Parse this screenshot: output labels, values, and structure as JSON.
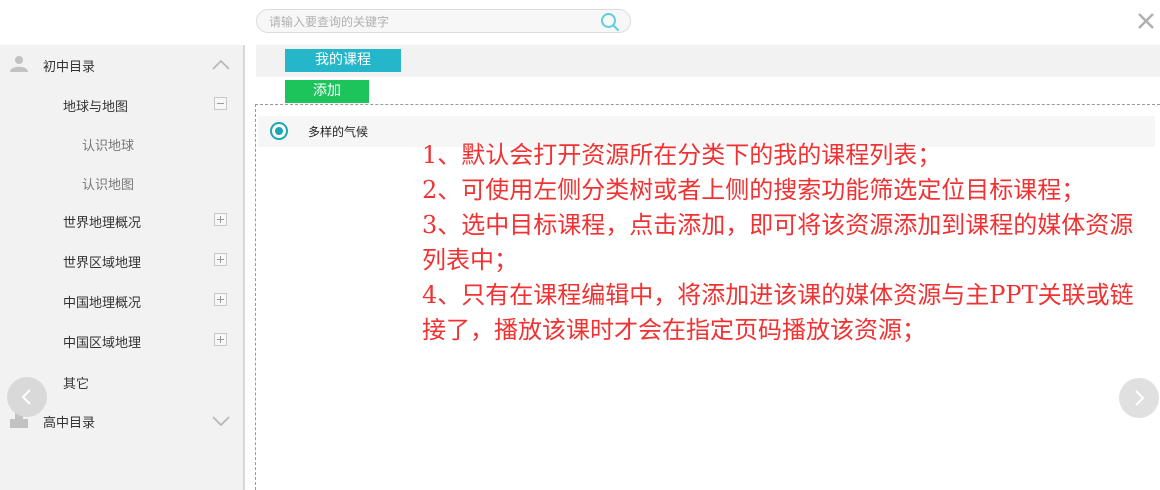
{
  "search": {
    "placeholder": "请输入要查询的关键字"
  },
  "sidebar": {
    "groups": [
      {
        "label": "初中目录",
        "nodes": [
          {
            "label": "地球与地图",
            "children": [
              "认识地球",
              "认识地图"
            ]
          },
          {
            "label": "世界地理概况"
          },
          {
            "label": "世界区域地理"
          },
          {
            "label": "中国地理概况"
          },
          {
            "label": "中国区域地理"
          },
          {
            "label": "其它"
          }
        ]
      },
      {
        "label": "高中目录"
      }
    ]
  },
  "toolbar": {
    "my_course_label": "我的课程",
    "add_label": "添加"
  },
  "courses": [
    {
      "label": "多样的气候",
      "selected": true
    }
  ],
  "notes": [
    "1、默认会打开资源所在分类下的我的课程列表；",
    "2、可使用左侧分类树或者上侧的搜索功能筛选定位目标课程；",
    "3、选中目标课程，点击添加，即可将该资源添加到课程的媒体资源列表中；",
    "4、只有在课程编辑中，将添加进该课的媒体资源与主PPT关联或链接了，播放该课时才会在指定页码播放该资源；"
  ],
  "colors": {
    "my_course_button": "#25b6c9",
    "add_button": "#1dc45c",
    "notes_text": "#f03232",
    "radio_accent": "#1aa7b3"
  }
}
